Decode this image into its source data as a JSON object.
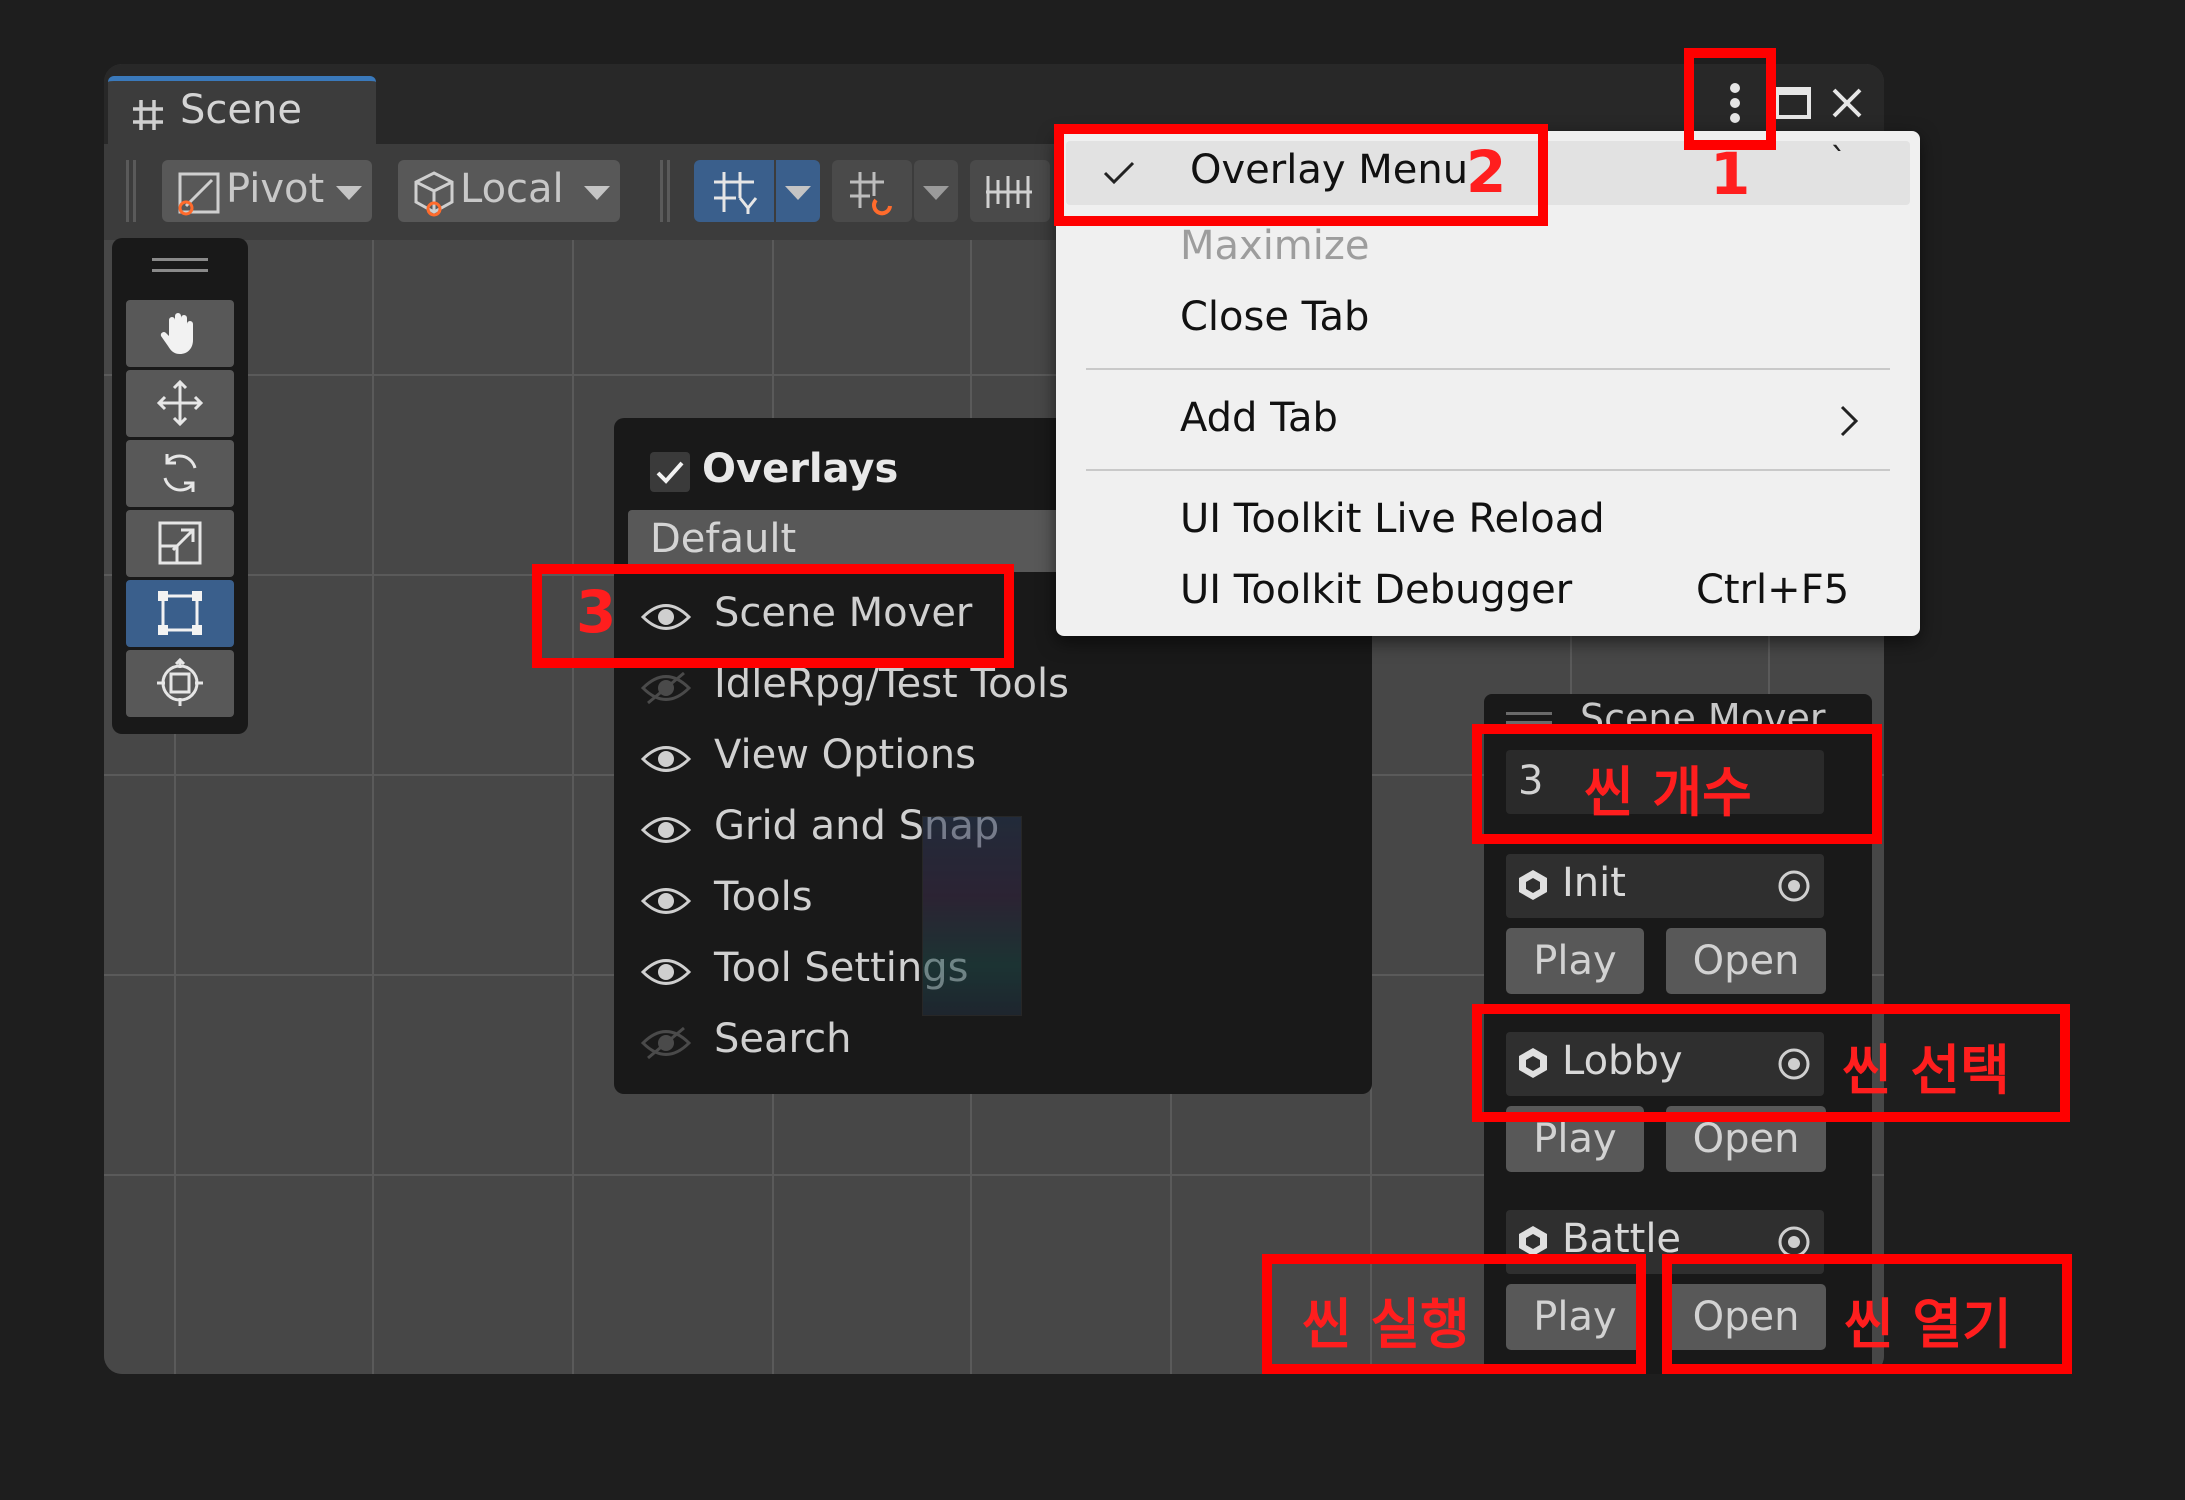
{
  "window": {
    "tab_title": "Scene",
    "tab_icon": "hash-grid-icon",
    "controls": {
      "more": "kebab-menu-icon",
      "maximize": "maximize-icon",
      "close": "close-icon"
    }
  },
  "toolbar": {
    "pivot_label": "Pivot",
    "local_label": "Local",
    "icons": [
      "pivot-icon",
      "local-cube-icon",
      "grid-snap-icon",
      "increment-snap-icon",
      "ruler-icon"
    ]
  },
  "tools": [
    {
      "name": "hand-tool",
      "icon": "hand-icon"
    },
    {
      "name": "move-tool",
      "icon": "move-arrows-icon"
    },
    {
      "name": "rotate-tool",
      "icon": "rotate-icon"
    },
    {
      "name": "scale-tool",
      "icon": "scale-icon"
    },
    {
      "name": "rect-tool",
      "icon": "rect-icon",
      "selected": true
    },
    {
      "name": "transform-tool",
      "icon": "transform-icon"
    }
  ],
  "overlays_panel": {
    "title": "Overlays",
    "preset": "Default",
    "items": [
      {
        "label": "Scene Mover",
        "visible": true
      },
      {
        "label": "IdleRpg/Test Tools",
        "visible": false
      },
      {
        "label": "View Options",
        "visible": true
      },
      {
        "label": "Grid and Snap",
        "visible": true
      },
      {
        "label": "Tools",
        "visible": true
      },
      {
        "label": "Tool Settings",
        "visible": true
      },
      {
        "label": "Search",
        "visible": false
      }
    ]
  },
  "context_menu": {
    "items": [
      {
        "label": "Overlay Menu",
        "checked": true
      },
      {
        "label": "Maximize",
        "disabled": true
      },
      {
        "label": "Close Tab"
      },
      {
        "label": "Add Tab",
        "submenu": true
      },
      {
        "label": "UI Toolkit Live Reload"
      },
      {
        "label": "UI Toolkit Debugger",
        "shortcut": "Ctrl+F5"
      }
    ],
    "stray_mark": "`"
  },
  "scene_mover": {
    "title": "Scene Mover",
    "count": "3",
    "scenes": [
      {
        "name": "Init"
      },
      {
        "name": "Lobby"
      },
      {
        "name": "Battle"
      }
    ],
    "play_label": "Play",
    "open_label": "Open"
  },
  "annotations": {
    "step1": "1",
    "step2": "2",
    "step3": "3",
    "scene_count": "씬 개수",
    "scene_select": "씬 선택",
    "scene_run": "씬 실행",
    "scene_open": "씬 열기",
    "color": "#ff0000"
  },
  "colors": {
    "background": "#1e1e1e",
    "panel": "#191919",
    "viewport": "#474747",
    "accent": "#3a79bb",
    "menu": "#f0f0f0"
  }
}
